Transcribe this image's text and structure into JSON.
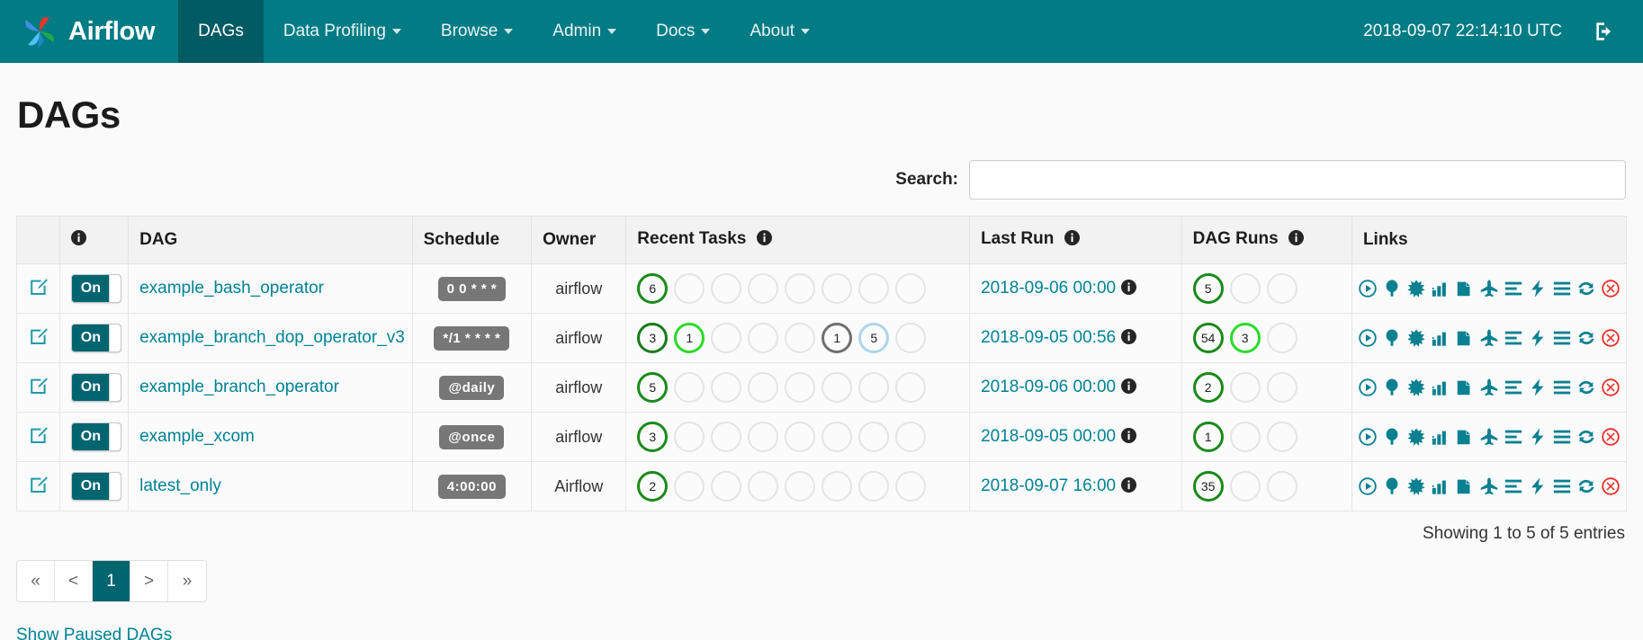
{
  "navbar": {
    "brand": "Airflow",
    "items": [
      {
        "label": "DAGs",
        "active": true,
        "caret": false
      },
      {
        "label": "Data Profiling",
        "active": false,
        "caret": true
      },
      {
        "label": "Browse",
        "active": false,
        "caret": true
      },
      {
        "label": "Admin",
        "active": false,
        "caret": true
      },
      {
        "label": "Docs",
        "active": false,
        "caret": true
      },
      {
        "label": "About",
        "active": false,
        "caret": true
      }
    ],
    "clock": "2018-09-07 22:14:10 UTC",
    "logout_icon": "sign-out-icon"
  },
  "page": {
    "title": "DAGs"
  },
  "search": {
    "label": "Search:",
    "value": "",
    "placeholder": ""
  },
  "table": {
    "headers": {
      "edit": "",
      "toggle_info": "info-icon",
      "dag": "DAG",
      "schedule": "Schedule",
      "owner": "Owner",
      "recent_tasks": "Recent Tasks",
      "last_run": "Last Run",
      "dag_runs": "DAG Runs",
      "links": "Links"
    },
    "rows": [
      {
        "edit_icon": "edit-square-icon",
        "toggle": "On",
        "dag": "example_bash_operator",
        "schedule": "0 0 * * *",
        "owner": "airflow",
        "recent_tasks": [
          {
            "count": "6",
            "color": "#1a8a1a",
            "filled": true
          },
          {
            "count": "",
            "color": "",
            "filled": false
          },
          {
            "count": "",
            "color": "",
            "filled": false
          },
          {
            "count": "",
            "color": "",
            "filled": false
          },
          {
            "count": "",
            "color": "",
            "filled": false
          },
          {
            "count": "",
            "color": "",
            "filled": false
          },
          {
            "count": "",
            "color": "",
            "filled": false
          },
          {
            "count": "",
            "color": "",
            "filled": false
          }
        ],
        "last_run": "2018-09-06 00:00",
        "dag_runs": [
          {
            "count": "5",
            "color": "#1a8a1a",
            "filled": true
          },
          {
            "count": "",
            "color": "",
            "filled": false
          },
          {
            "count": "",
            "color": "",
            "filled": false
          }
        ]
      },
      {
        "edit_icon": "edit-square-icon",
        "toggle": "On",
        "dag": "example_branch_dop_operator_v3",
        "schedule": "*/1 * * * *",
        "owner": "airflow",
        "recent_tasks": [
          {
            "count": "3",
            "color": "#1a7a1a",
            "filled": true
          },
          {
            "count": "1",
            "color": "#2bdb2b",
            "filled": true
          },
          {
            "count": "",
            "color": "",
            "filled": false
          },
          {
            "count": "",
            "color": "",
            "filled": false
          },
          {
            "count": "",
            "color": "",
            "filled": false
          },
          {
            "count": "1",
            "color": "#6f6f6f",
            "filled": true
          },
          {
            "count": "5",
            "color": "#aed6e8",
            "filled": true
          },
          {
            "count": "",
            "color": "",
            "filled": false
          }
        ],
        "last_run": "2018-09-05 00:56",
        "dag_runs": [
          {
            "count": "54",
            "color": "#1a8a1a",
            "filled": true
          },
          {
            "count": "3",
            "color": "#2bdb2b",
            "filled": true
          },
          {
            "count": "",
            "color": "",
            "filled": false
          }
        ]
      },
      {
        "edit_icon": "edit-square-icon",
        "toggle": "On",
        "dag": "example_branch_operator",
        "schedule": "@daily",
        "owner": "airflow",
        "recent_tasks": [
          {
            "count": "5",
            "color": "#1a8a1a",
            "filled": true
          },
          {
            "count": "",
            "color": "",
            "filled": false
          },
          {
            "count": "",
            "color": "",
            "filled": false
          },
          {
            "count": "",
            "color": "",
            "filled": false
          },
          {
            "count": "",
            "color": "",
            "filled": false
          },
          {
            "count": "",
            "color": "",
            "filled": false
          },
          {
            "count": "",
            "color": "",
            "filled": false
          },
          {
            "count": "",
            "color": "",
            "filled": false
          }
        ],
        "last_run": "2018-09-06 00:00",
        "dag_runs": [
          {
            "count": "2",
            "color": "#1a8a1a",
            "filled": true
          },
          {
            "count": "",
            "color": "",
            "filled": false
          },
          {
            "count": "",
            "color": "",
            "filled": false
          }
        ]
      },
      {
        "edit_icon": "edit-square-icon",
        "toggle": "On",
        "dag": "example_xcom",
        "schedule": "@once",
        "owner": "airflow",
        "recent_tasks": [
          {
            "count": "3",
            "color": "#1a8a1a",
            "filled": true
          },
          {
            "count": "",
            "color": "",
            "filled": false
          },
          {
            "count": "",
            "color": "",
            "filled": false
          },
          {
            "count": "",
            "color": "",
            "filled": false
          },
          {
            "count": "",
            "color": "",
            "filled": false
          },
          {
            "count": "",
            "color": "",
            "filled": false
          },
          {
            "count": "",
            "color": "",
            "filled": false
          },
          {
            "count": "",
            "color": "",
            "filled": false
          }
        ],
        "last_run": "2018-09-05 00:00",
        "dag_runs": [
          {
            "count": "1",
            "color": "#1a8a1a",
            "filled": true
          },
          {
            "count": "",
            "color": "",
            "filled": false
          },
          {
            "count": "",
            "color": "",
            "filled": false
          }
        ]
      },
      {
        "edit_icon": "edit-square-icon",
        "toggle": "On",
        "dag": "latest_only",
        "schedule": "4:00:00",
        "owner": "Airflow",
        "recent_tasks": [
          {
            "count": "2",
            "color": "#1a8a1a",
            "filled": true
          },
          {
            "count": "",
            "color": "",
            "filled": false
          },
          {
            "count": "",
            "color": "",
            "filled": false
          },
          {
            "count": "",
            "color": "",
            "filled": false
          },
          {
            "count": "",
            "color": "",
            "filled": false
          },
          {
            "count": "",
            "color": "",
            "filled": false
          },
          {
            "count": "",
            "color": "",
            "filled": false
          },
          {
            "count": "",
            "color": "",
            "filled": false
          }
        ],
        "last_run": "2018-09-07 16:00",
        "dag_runs": [
          {
            "count": "35",
            "color": "#1a8a1a",
            "filled": true
          },
          {
            "count": "",
            "color": "",
            "filled": false
          },
          {
            "count": "",
            "color": "",
            "filled": false
          }
        ]
      }
    ],
    "link_icons": [
      "trigger-dag-play-icon",
      "tree-view-icon",
      "graph-view-icon",
      "task-duration-bar-chart-icon",
      "task-tries-clipboard-icon",
      "landing-times-plane-icon",
      "gantt-align-icon",
      "code-bolt-icon",
      "logs-list-icon",
      "refresh-icon",
      "delete-dag-times-circle-icon"
    ],
    "link_icon_color": "#0a8091",
    "delete_icon_color": "#e8302a"
  },
  "footer": {
    "entries": "Showing 1 to 5 of 5 entries",
    "pagination": [
      {
        "label": "«",
        "active": false
      },
      {
        "label": "<",
        "active": false
      },
      {
        "label": "1",
        "active": true
      },
      {
        "label": ">",
        "active": false
      },
      {
        "label": "»",
        "active": false
      }
    ],
    "show_paused": "Show Paused DAGs"
  },
  "colors": {
    "navbar": "#017b84",
    "navbar_active": "#015b62",
    "accent_link": "#018294",
    "toggle_on": "#016570",
    "badge_gray": "#777777"
  }
}
